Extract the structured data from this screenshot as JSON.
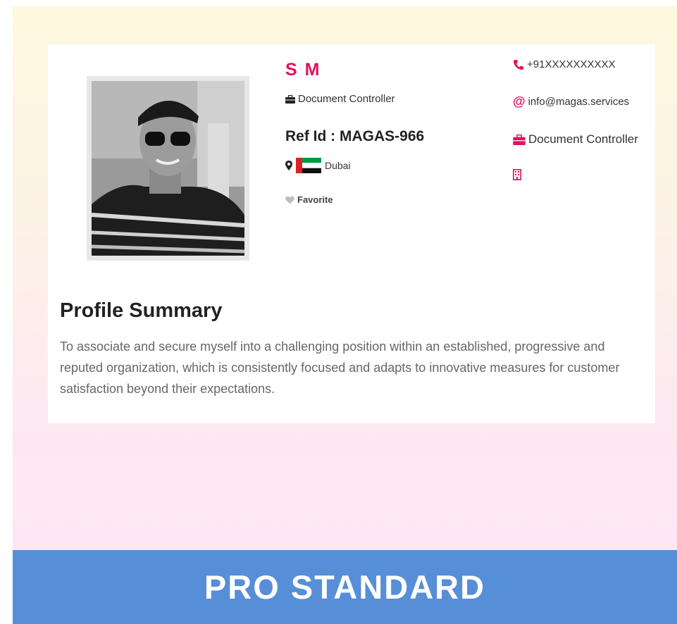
{
  "profile": {
    "name": "S M",
    "role": "Document Controller",
    "ref_id": "Ref Id : MAGAS-966",
    "location": "Dubai",
    "favorite_label": "Favorite"
  },
  "contact": {
    "phone": "+91XXXXXXXXXX",
    "email": "info@magas.services",
    "position": "Document Controller"
  },
  "summary": {
    "title": "Profile Summary",
    "text": "To associate and secure myself into a challenging position within an established, progressive and reputed organization, which is consistently focused and adapts to innovative measures for customer satisfaction beyond their expectations."
  },
  "banner": {
    "label": "PRO STANDARD"
  },
  "colors": {
    "accent": "#e0125e",
    "banner": "#578ed8"
  },
  "icons": {
    "role": "briefcase-icon",
    "location": "map-pin-icon",
    "flag": "uae-flag-icon",
    "favorite": "heart-icon",
    "phone": "phone-icon",
    "email": "at-icon",
    "position": "briefcase-icon",
    "company": "building-icon"
  }
}
